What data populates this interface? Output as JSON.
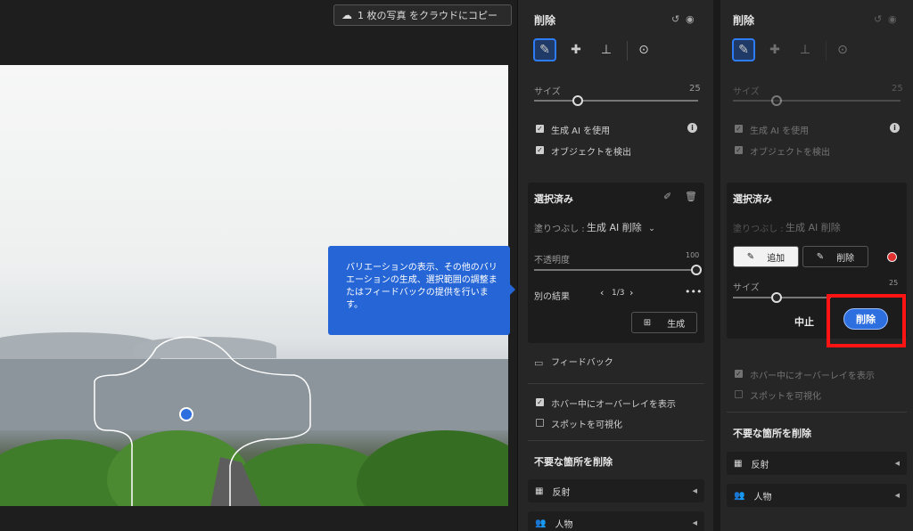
{
  "toolbar": {
    "copy_label": "1 枚の写真 をクラウドにコピー"
  },
  "tooltip": {
    "text": "バリエーションの表示、その他のバリエーションの生成、選択範囲の調整またはフィードバックの提供を行います。"
  },
  "panel1": {
    "title": "削除",
    "size_label": "サイズ",
    "size_value": "25",
    "use_ai_label": "生成 AI を使用",
    "detect_objects_label": "オブジェクトを検出",
    "selected_title": "選択済み",
    "fill_label": "塗りつぶし :",
    "fill_value": "生成 AI 削除",
    "opacity_label": "不透明度",
    "opacity_value": "100",
    "opacity_level": 1.0,
    "other_results_label": "別の結果",
    "page_indicator": "1/3",
    "generate_label": "生成",
    "feedback_label": "フィードバック",
    "overlay_label": "ホバー中にオーバーレイを表示",
    "spots_label": "スポットを可視化",
    "remove_title": "不要な箇所を削除",
    "reflection_label": "反射",
    "people_label": "人物"
  },
  "panel2": {
    "title": "削除",
    "size_label": "サイズ",
    "size_value": "25",
    "use_ai_label": "生成 AI を使用",
    "detect_objects_label": "オブジェクトを検出",
    "selected_title": "選択済み",
    "fill_label": "塗りつぶし :",
    "fill_value": "生成 AI 削除",
    "add_label": "追加",
    "subtract_label": "削除",
    "size2_label": "サイズ",
    "size2_value": "25",
    "cancel_label": "中止",
    "run_label": "削除",
    "overlay_label": "ホバー中にオーバーレイを表示",
    "spots_label": "スポットを可視化",
    "remove_title": "不要な箇所を削除",
    "reflection_label": "反射",
    "people_label": "人物"
  },
  "colors": {
    "accent": "#2e6fe0",
    "highlight": "#ff1313",
    "tooltip": "#2565d6"
  },
  "icons": [
    "cloud-upload-icon",
    "eraser-icon",
    "bandage-icon",
    "stamp-icon",
    "eye-plus-icon",
    "undo-icon",
    "eye-icon",
    "info-icon",
    "brush-icon",
    "trash-icon",
    "chevron-down-icon",
    "chevron-left-icon",
    "chevron-right-icon",
    "more-icon",
    "generate-icon",
    "feedback-icon",
    "reflection-icon",
    "people-icon"
  ]
}
